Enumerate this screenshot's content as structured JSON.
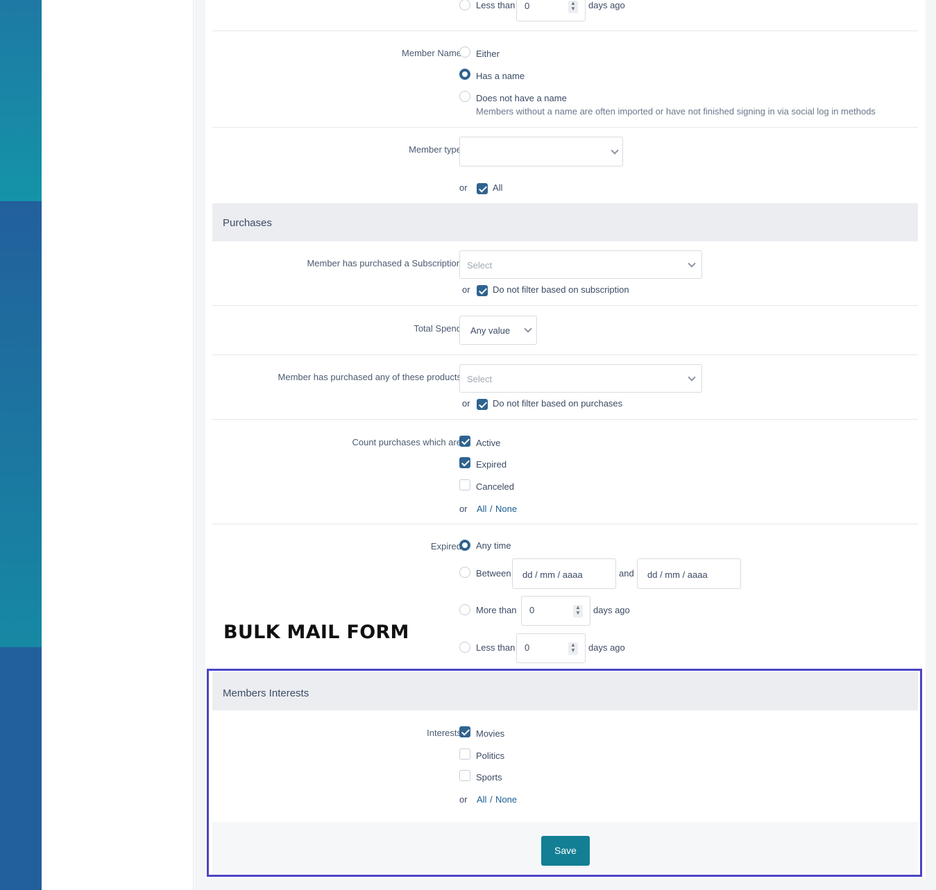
{
  "colors": {
    "accent": "#127f95",
    "checked": "#2f6390",
    "highlight": "#4a45c4"
  },
  "top_partial": {
    "option_label": "Less than",
    "value": "0",
    "suffix": "days ago"
  },
  "member_name": {
    "label": "Member Name",
    "options": [
      "Either",
      "Has a name",
      "Does not have a name"
    ],
    "selected": "Has a name",
    "hint": "Members without a name are often imported or have not finished signing in via social log in methods"
  },
  "member_type": {
    "label": "Member type",
    "select_value": "",
    "or_label": "or",
    "all_label": "All",
    "all_checked": true
  },
  "purchases": {
    "heading": "Purchases",
    "subscription": {
      "label": "Member has purchased a Subscription",
      "placeholder": "Select",
      "or_label": "or",
      "no_filter_label": "Do not filter based on subscription"
    },
    "total_spend": {
      "label": "Total Spend",
      "value": "Any value"
    },
    "products": {
      "label": "Member has purchased any of these products",
      "placeholder": "Select",
      "or_label": "or",
      "no_filter_label": "Do not filter based on purchases"
    },
    "count_purchases": {
      "label": "Count purchases which are",
      "options": [
        {
          "label": "Active",
          "checked": true
        },
        {
          "label": "Expired",
          "checked": true
        },
        {
          "label": "Canceled",
          "checked": false
        }
      ],
      "or_label": "or",
      "all_label": "All",
      "sep": "/",
      "none_label": "None"
    },
    "expired": {
      "label": "Expired",
      "any_time": "Any time",
      "between": "Between",
      "date_from": "dd / mm / aaaa",
      "and_label": "and",
      "date_to": "dd / mm / aaaa",
      "more_than": "More than",
      "more_value": "0",
      "less_than": "Less than",
      "less_value": "0",
      "days_ago": "days ago",
      "selected": "Any time"
    }
  },
  "overlay_title": "BULK MAIL FORM",
  "interests": {
    "heading": "Members Interests",
    "label": "Interests",
    "options": [
      {
        "label": "Movies",
        "checked": true
      },
      {
        "label": "Politics",
        "checked": false
      },
      {
        "label": "Sports",
        "checked": false
      }
    ],
    "or_label": "or",
    "all_label": "All",
    "sep": "/",
    "none_label": "None"
  },
  "save_label": "Save"
}
